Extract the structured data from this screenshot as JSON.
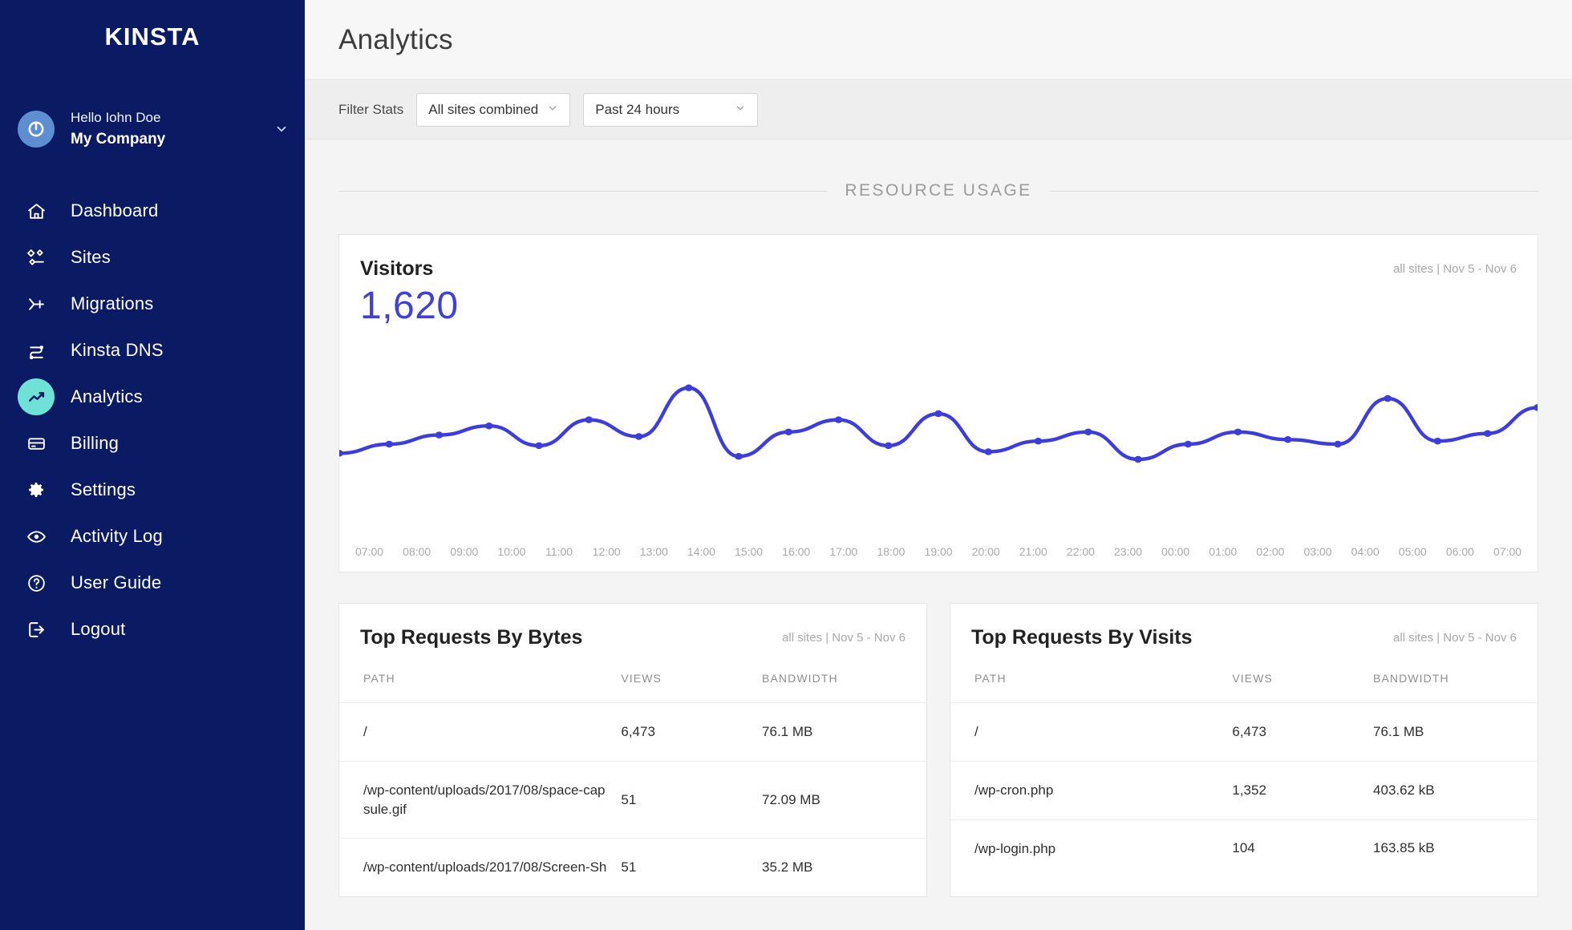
{
  "sidebar": {
    "logo": "KINSTA",
    "account": {
      "hello": "Hello Iohn Doe",
      "company": "My Company",
      "caret_icon": "chevron-down-icon",
      "avatar_icon": "power-avatar-icon"
    },
    "items": [
      {
        "label": "Dashboard",
        "icon": "home-icon",
        "active": false
      },
      {
        "label": "Sites",
        "icon": "sites-icon",
        "active": false
      },
      {
        "label": "Migrations",
        "icon": "migrations-icon",
        "active": false
      },
      {
        "label": "Kinsta DNS",
        "icon": "dns-icon",
        "active": false
      },
      {
        "label": "Analytics",
        "icon": "analytics-icon",
        "active": true
      },
      {
        "label": "Billing",
        "icon": "card-icon",
        "active": false
      },
      {
        "label": "Settings",
        "icon": "gear-icon",
        "active": false
      },
      {
        "label": "Activity Log",
        "icon": "eye-icon",
        "active": false
      },
      {
        "label": "User Guide",
        "icon": "question-icon",
        "active": false
      },
      {
        "label": "Logout",
        "icon": "logout-icon",
        "active": false
      }
    ]
  },
  "header": {
    "title": "Analytics"
  },
  "filter": {
    "label": "Filter Stats",
    "site_select": {
      "value": "All sites combined",
      "chevron": "chevron-down-icon"
    },
    "range_select": {
      "value": "Past 24 hours",
      "chevron": "chevron-down-icon"
    }
  },
  "section": {
    "resource_usage": "RESOURCE USAGE"
  },
  "visitors_card": {
    "title": "Visitors",
    "value": "1,620",
    "meta": "all sites | Nov 5 - Nov 6"
  },
  "chart_data": {
    "type": "line",
    "title": "Visitors",
    "xlabel": "",
    "ylabel": "Visitors",
    "grid": false,
    "legend": null,
    "accent_color": "#3d3ddb",
    "categories": [
      "07:00",
      "08:00",
      "09:00",
      "10:00",
      "11:00",
      "12:00",
      "13:00",
      "14:00",
      "15:00",
      "16:00",
      "17:00",
      "18:00",
      "19:00",
      "20:00",
      "21:00",
      "22:00",
      "23:00",
      "00:00",
      "01:00",
      "02:00",
      "03:00",
      "04:00",
      "05:00",
      "06:00",
      "07:00"
    ],
    "values": [
      44,
      50,
      56,
      62,
      49,
      66,
      55,
      87,
      42,
      58,
      66,
      49,
      70,
      45,
      52,
      58,
      40,
      50,
      58,
      53,
      50,
      80,
      52,
      57,
      74
    ],
    "ylim": [
      0,
      100
    ]
  },
  "tables": [
    {
      "title": "Top Requests By Bytes",
      "meta": "all sites | Nov 5 - Nov 6",
      "columns": [
        "PATH",
        "VIEWS",
        "BANDWIDTH"
      ],
      "rows": [
        {
          "path": "/",
          "views": "6,473",
          "bandwidth": "76.1 MB"
        },
        {
          "path": "/wp-content/uploads/2017/08/space-capsule.gif",
          "views": "51",
          "bandwidth": "72.09 MB"
        },
        {
          "path": "/wp-content/uploads/2017/08/Screen-Sh",
          "views": "51",
          "bandwidth": "35.2 MB"
        }
      ]
    },
    {
      "title": "Top Requests By Visits",
      "meta": "all sites | Nov 5 - Nov 6",
      "columns": [
        "PATH",
        "VIEWS",
        "BANDWIDTH"
      ],
      "rows": [
        {
          "path": "/",
          "views": "6,473",
          "bandwidth": "76.1 MB"
        },
        {
          "path": "/wp-cron.php",
          "views": "1,352",
          "bandwidth": "403.62 kB"
        },
        {
          "path": "/wp-login.php",
          "views": "104",
          "bandwidth": "163.85 kB"
        }
      ]
    }
  ]
}
